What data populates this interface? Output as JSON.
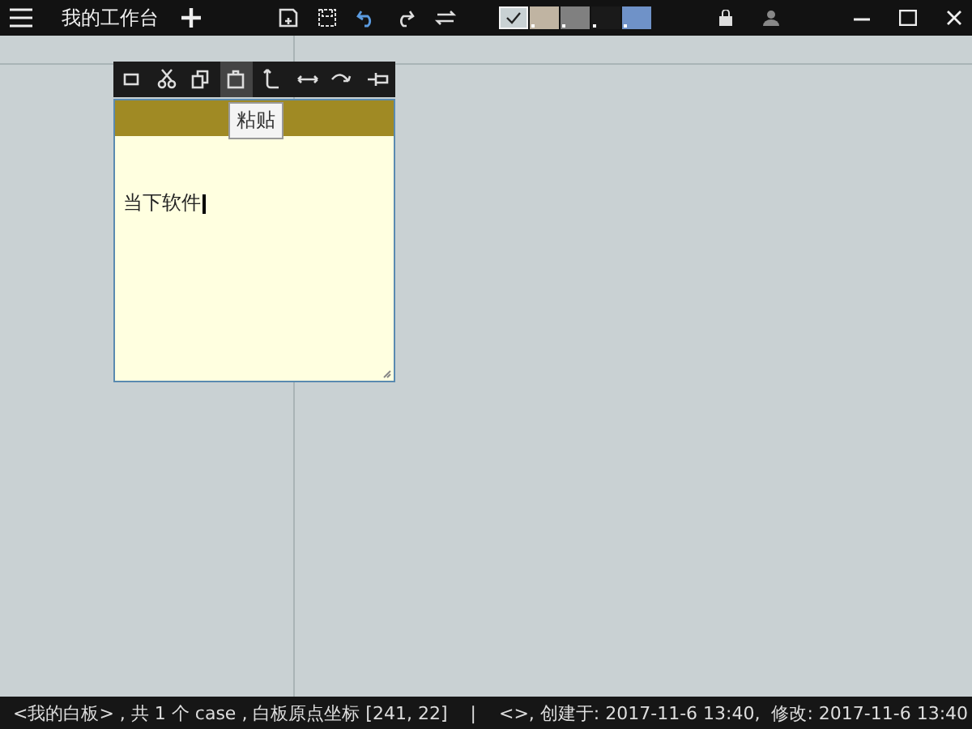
{
  "topbar": {
    "title": "我的工作台",
    "swatches": [
      {
        "color": "#c9d1d3",
        "selected": true
      },
      {
        "color": "#c0b4a2",
        "selected": false
      },
      {
        "color": "#808080",
        "selected": false
      },
      {
        "color": "#1a1a1a",
        "selected": false
      },
      {
        "color": "#6f92c8",
        "selected": false
      }
    ]
  },
  "card": {
    "toolbar": [
      {
        "kind": "rect",
        "selected": false
      },
      {
        "kind": "cut",
        "selected": false
      },
      {
        "kind": "copy",
        "selected": false
      },
      {
        "kind": "paste",
        "selected": true
      },
      {
        "kind": "corner",
        "selected": false
      },
      {
        "kind": "double",
        "selected": false
      },
      {
        "kind": "curve",
        "selected": false
      },
      {
        "kind": "pin",
        "selected": false
      }
    ],
    "tooltip": "粘贴",
    "text": "当下软件"
  },
  "status_bar": {
    "left": "<我的白板> , 共 1 个 case , 白板原点坐标 [241, 22]",
    "separator": "|",
    "right": "<>, 创建于: 2017-11-6 13:40,  修改: 2017-11-6 13:40"
  }
}
